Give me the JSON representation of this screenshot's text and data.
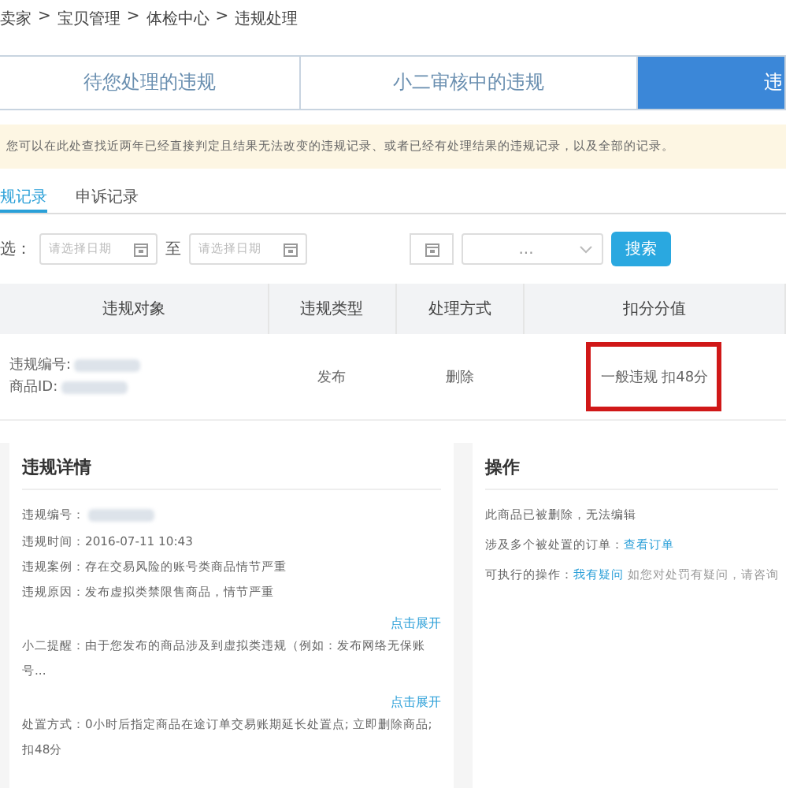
{
  "breadcrumb": [
    "卖家",
    "宝贝管理",
    "体检中心",
    "违规处理"
  ],
  "breadcrumb_separator": ">",
  "tabs": [
    {
      "label": "待您处理的违规",
      "selected": false
    },
    {
      "label": "小二审核中的违规",
      "selected": false
    },
    {
      "label": "违",
      "selected": true
    }
  ],
  "notice": "您可以在此处查找近两年已经直接判定且结果无法改变的违规记录、或者已经有处理结果的违规记录，以及全部的记录。",
  "subtabs": [
    {
      "label": "规记录",
      "selected": true
    },
    {
      "label": "申诉记录",
      "selected": false
    }
  ],
  "filter": {
    "label": "选：",
    "from_placeholder": "请选择日期",
    "separator": "至",
    "to_placeholder": "请选择日期",
    "select_value": "...",
    "search_button": "搜索"
  },
  "table": {
    "columns": [
      "违规对象",
      "违规类型",
      "处理方式",
      "扣分分值"
    ],
    "rows": [
      {
        "object_lines": [
          "违规编号:",
          "商品ID:"
        ],
        "type": "发布",
        "action": "删除",
        "score": "一般违规 扣48分",
        "highlighted": true
      }
    ]
  },
  "details": {
    "title": "违规详情",
    "lines": [
      {
        "kind": "redacted",
        "label": "违规编号："
      },
      {
        "kind": "text",
        "text": "违规时间：2016-07-11 10:43"
      },
      {
        "kind": "text",
        "text": "违规案例：存在交易风险的账号类商品情节严重"
      },
      {
        "kind": "text",
        "text": "违规原因：发布虚拟类禁限售商品，情节严重"
      },
      {
        "kind": "link",
        "text": "点击展开"
      },
      {
        "kind": "text",
        "text": "小二提醒：由于您发布的商品涉及到虚拟类违规（例如：发布网络无保账号..."
      },
      {
        "kind": "link",
        "text": "点击展开"
      },
      {
        "kind": "text",
        "text": "处置方式：0小时后指定商品在途订单交易账期延长处置点; 立即删除商品; 扣48分"
      }
    ]
  },
  "operations": {
    "title": "操作",
    "lines": [
      {
        "text": "此商品已被删除，无法编辑"
      },
      {
        "text": "涉及多个被处置的订单：",
        "link": "查看订单"
      },
      {
        "text": "可执行的操作：",
        "link": "我有疑问",
        "note": "如您对处罚有疑问，请咨询"
      }
    ]
  }
}
